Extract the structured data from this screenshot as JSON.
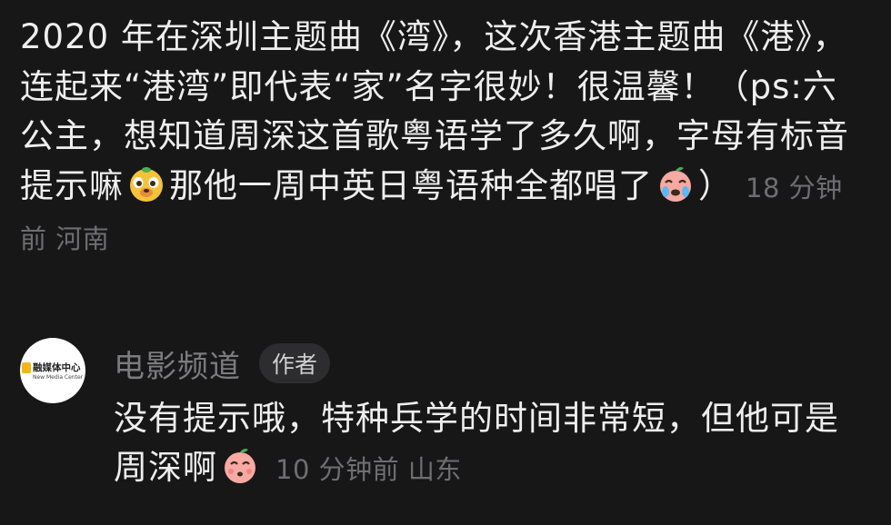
{
  "comment": {
    "text": "2020 年在深圳主题曲《湾》，这次香港主题曲《港》，连起来“港湾”即代表“家”名字很妙！很温馨！（ps:六公主，想知道周深这首歌粤语学了多久啊，字母有标音提示嘛",
    "text_after_emoji": "那他一周中英日粤语种全都唱了",
    "text_end": "）",
    "emoji_1": "smirk-mole-emoji",
    "emoji_2": "crying-peach-emoji",
    "time": "18 分钟前",
    "location": "河南"
  },
  "reply": {
    "author": "电影频道",
    "author_tag": "作者",
    "avatar": {
      "brand_cn": "融媒体中心",
      "brand_en": "New Media Center",
      "icon": "media-center-logo-icon"
    },
    "text": "没有提示哦，特种兵学的时间非常短，但他可是周深啊",
    "emoji": "shy-peach-emoji",
    "time": "10 分钟前",
    "location": "山东"
  },
  "colors": {
    "background": "#171718",
    "text": "#eeeeee",
    "meta": "#6e6e72",
    "tag_bg": "#2d2d30"
  }
}
